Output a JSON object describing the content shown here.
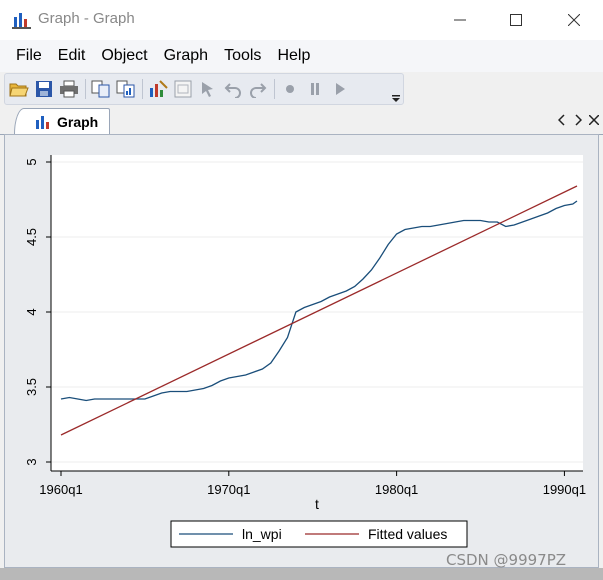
{
  "window": {
    "title": "Graph - Graph"
  },
  "menu": {
    "items": [
      "File",
      "Edit",
      "Object",
      "Graph",
      "Tools",
      "Help"
    ]
  },
  "toolbar": {
    "buttons": [
      "open-icon",
      "save-icon",
      "print-icon",
      "copy-icon",
      "copy-graph-icon",
      "graph-editor-icon",
      "properties-icon",
      "pointer-icon",
      "undo-icon",
      "redo-icon",
      "record-icon",
      "pause-icon",
      "play-icon"
    ]
  },
  "tab": {
    "label": "Graph"
  },
  "colors": {
    "ln_wpi": "#1a4e7a",
    "fitted": "#9b2a2a",
    "plot_bg": "#ffffff",
    "outer_bg": "#e9ebee"
  },
  "chart_data": {
    "type": "line",
    "xlabel": "t",
    "ylabel": "",
    "x_ticks": [
      "1960q1",
      "1970q1",
      "1980q1",
      "1990q1"
    ],
    "x_tick_values": [
      1960.0,
      1970.0,
      1980.0,
      1990.0
    ],
    "xlim": [
      1960.0,
      1990.75
    ],
    "y_ticks": [
      "3",
      "3.5",
      "4",
      "4.5",
      "5"
    ],
    "y_tick_values": [
      3.0,
      3.5,
      4.0,
      4.5,
      5.0
    ],
    "ylim": [
      3.0,
      5.0
    ],
    "grid": true,
    "legend_position": "bottom-center",
    "series": [
      {
        "name": "ln_wpi",
        "x": [
          1960.0,
          1960.5,
          1961.0,
          1961.5,
          1962.0,
          1963.0,
          1964.0,
          1965.0,
          1965.5,
          1966.0,
          1966.5,
          1967.0,
          1967.5,
          1968.0,
          1968.5,
          1969.0,
          1969.5,
          1970.0,
          1970.5,
          1971.0,
          1971.5,
          1972.0,
          1972.5,
          1973.0,
          1973.5,
          1974.0,
          1974.5,
          1975.0,
          1975.5,
          1976.0,
          1976.5,
          1977.0,
          1977.5,
          1978.0,
          1978.5,
          1979.0,
          1979.5,
          1980.0,
          1980.5,
          1981.0,
          1981.5,
          1982.0,
          1982.5,
          1983.0,
          1983.5,
          1984.0,
          1984.5,
          1985.0,
          1985.5,
          1986.0,
          1986.5,
          1987.0,
          1987.5,
          1988.0,
          1988.5,
          1989.0,
          1989.5,
          1990.0,
          1990.5,
          1990.75
        ],
        "values": [
          3.42,
          3.43,
          3.42,
          3.41,
          3.42,
          3.42,
          3.42,
          3.42,
          3.44,
          3.46,
          3.47,
          3.47,
          3.47,
          3.48,
          3.49,
          3.51,
          3.54,
          3.56,
          3.57,
          3.58,
          3.6,
          3.62,
          3.66,
          3.74,
          3.83,
          4.0,
          4.03,
          4.05,
          4.07,
          4.1,
          4.12,
          4.14,
          4.17,
          4.22,
          4.28,
          4.36,
          4.45,
          4.52,
          4.55,
          4.56,
          4.57,
          4.57,
          4.58,
          4.59,
          4.6,
          4.61,
          4.61,
          4.61,
          4.6,
          4.6,
          4.57,
          4.58,
          4.6,
          4.62,
          4.64,
          4.66,
          4.69,
          4.71,
          4.72,
          4.74
        ]
      },
      {
        "name": "Fitted values",
        "x": [
          1960.0,
          1990.75
        ],
        "values": [
          3.18,
          4.84
        ]
      }
    ]
  },
  "watermark": "CSDN @9997PZ"
}
